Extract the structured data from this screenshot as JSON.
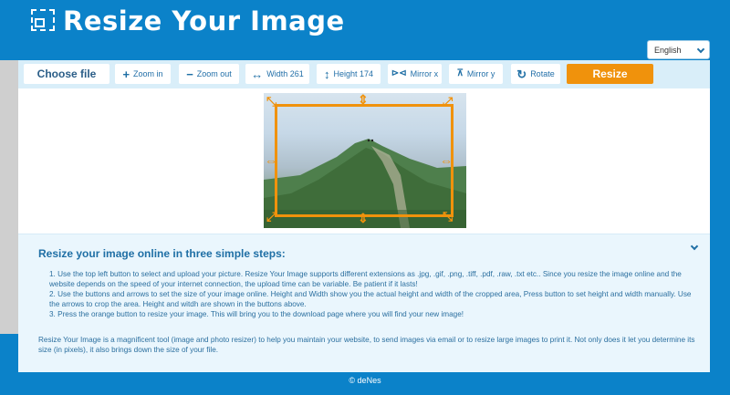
{
  "header": {
    "title": "Resize Your Image"
  },
  "language": {
    "selected": "English"
  },
  "toolbar": {
    "choose_file": "Choose file",
    "zoom_in": "Zoom in",
    "zoom_out": "Zoom out",
    "width": "Width 261",
    "height": "Height 174",
    "mirror_x": "Mirror x",
    "mirror_y": "Mirror y",
    "rotate": "Rotate",
    "resize": "Resize"
  },
  "icons": {
    "zoom_in": "plus-icon",
    "zoom_out": "minus-icon",
    "width": "horizontal-arrows-icon",
    "height": "vertical-arrows-icon",
    "mirror_x": "mirror-horizontal-icon",
    "mirror_y": "mirror-vertical-icon",
    "rotate": "rotate-icon"
  },
  "colors": {
    "brand_blue": "#0b82c9",
    "accent_orange": "#f0920c",
    "text_blue": "#1f6fa5"
  },
  "info": {
    "title": "Resize your image online in three simple steps:",
    "steps": [
      "1. Use the top left button to select and upload your picture. Resize Your Image supports different extensions as .jpg, .gif, .png, .tiff, .pdf, .raw, .txt etc.. Since you resize the image online and the website depends on the speed of your internet connection, the upload time can be variable. Be patient if it lasts!",
      "2. Use the buttons and arrows to set the size of your image online. Height and Width show you the actual height and width of the cropped area, Press button to set height and width manually. Use the arrows to crop the area. Height and witdh are shown in the buttons above.",
      "3. Press the orange button to resize your image. This will bring you to the download page where you will find your new image!"
    ],
    "paragraph": "Resize Your Image is a magnificent tool (image and photo resizer) to help you maintain your website, to send images via email or to resize large images to print it. Not only does it let you determine its size (in pixels), it also brings down the size of your file."
  },
  "footer": {
    "text": "© deNes"
  }
}
